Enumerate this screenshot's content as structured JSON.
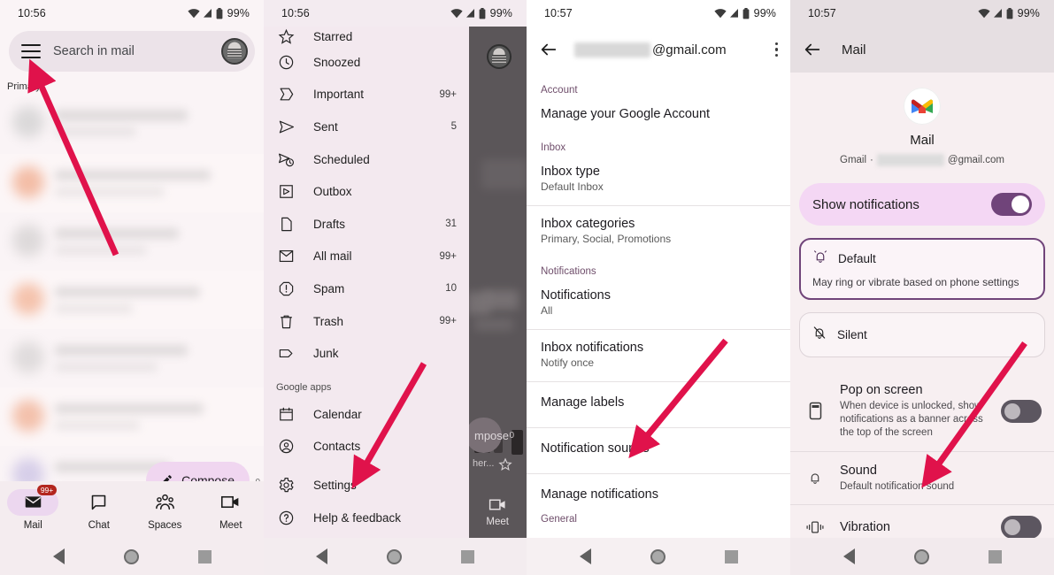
{
  "status_bar": {
    "time_1": "10:56",
    "time_2": "10:56",
    "time_3": "10:57",
    "time_4": "10:57",
    "battery": "99%"
  },
  "panel1": {
    "search": {
      "placeholder": "Search in mail",
      "menu_icon": "hamburger-menu-icon",
      "avatar_icon": "account-avatar"
    },
    "category_label": "Primary",
    "compose": {
      "label": "Compose",
      "icon": "pencil-icon"
    },
    "compose_side_mark": "0",
    "bottom_nav": [
      {
        "label": "Mail",
        "icon": "envelope-icon",
        "badge": "99+",
        "active": true
      },
      {
        "label": "Chat",
        "icon": "chat-bubble-icon",
        "badge": "",
        "active": false
      },
      {
        "label": "Spaces",
        "icon": "spaces-people-icon",
        "badge": "",
        "active": false
      },
      {
        "label": "Meet",
        "icon": "video-camera-icon",
        "badge": "",
        "active": false
      }
    ]
  },
  "panel2": {
    "items": [
      {
        "label": "Starred",
        "icon": "star-icon",
        "count": ""
      },
      {
        "label": "Snoozed",
        "icon": "clock-icon",
        "count": ""
      },
      {
        "label": "Important",
        "icon": "important-chevron-icon",
        "count": "99+"
      },
      {
        "label": "Sent",
        "icon": "paper-plane-icon",
        "count": "5"
      },
      {
        "label": "Scheduled",
        "icon": "scheduled-send-icon",
        "count": ""
      },
      {
        "label": "Outbox",
        "icon": "outbox-icon",
        "count": ""
      },
      {
        "label": "Drafts",
        "icon": "draft-page-icon",
        "count": "31"
      },
      {
        "label": "All mail",
        "icon": "all-mail-icon",
        "count": "99+"
      },
      {
        "label": "Spam",
        "icon": "spam-exclamation-icon",
        "count": "10"
      },
      {
        "label": "Trash",
        "icon": "trash-icon",
        "count": "99+"
      },
      {
        "label": "Junk",
        "icon": "label-tag-icon",
        "count": ""
      }
    ],
    "section_label": "Google apps",
    "apps": [
      {
        "label": "Calendar",
        "icon": "calendar-icon"
      },
      {
        "label": "Contacts",
        "icon": "contacts-person-icon"
      }
    ],
    "footer": [
      {
        "label": "Settings",
        "icon": "gear-icon"
      },
      {
        "label": "Help & feedback",
        "icon": "help-question-icon"
      }
    ],
    "overlay": {
      "compose_label": "mpose",
      "zero": "0",
      "her": "her...",
      "meet": "Meet"
    }
  },
  "panel3": {
    "email_suffix": "@gmail.com",
    "sections": [
      {
        "label": "Account",
        "rows": [
          {
            "title": "Manage your Google Account",
            "sub": ""
          }
        ]
      },
      {
        "label": "Inbox",
        "rows": [
          {
            "title": "Inbox type",
            "sub": "Default Inbox"
          },
          {
            "title": "Inbox categories",
            "sub": "Primary, Social, Promotions"
          }
        ]
      },
      {
        "label": "Notifications",
        "rows": [
          {
            "title": "Notifications",
            "sub": "All"
          },
          {
            "title": "Inbox notifications",
            "sub": "Notify once"
          },
          {
            "title": "Manage labels",
            "sub": ""
          },
          {
            "title": "Notification sounds",
            "sub": ""
          },
          {
            "title": "Manage notifications",
            "sub": ""
          }
        ]
      },
      {
        "label": "General",
        "rows": []
      }
    ]
  },
  "panel4": {
    "appbar_title": "Mail",
    "app_name": "Mail",
    "app_sub_prefix": "Gmail",
    "app_sub_separator": "·",
    "app_sub_suffix": "@gmail.com",
    "show_notifications": {
      "label": "Show notifications",
      "state": "on"
    },
    "importance": [
      {
        "label": "Default",
        "desc": "May ring or vibrate based on phone settings",
        "icon": "bell-ring-icon",
        "selected": true
      },
      {
        "label": "Silent",
        "desc": "",
        "icon": "bell-off-icon",
        "selected": false
      }
    ],
    "rows": [
      {
        "title": "Pop on screen",
        "sub": "When device is unlocked, show notifications as a banner across the top of the screen",
        "icon": "phone-banner-icon",
        "toggle": "off"
      },
      {
        "title": "Sound",
        "sub": "Default notification sound",
        "icon": "bell-icon",
        "toggle": ""
      },
      {
        "title": "Vibration",
        "sub": "",
        "icon": "vibration-icon",
        "toggle": "off"
      }
    ]
  },
  "annotations": {
    "arrow_color": "#e0124b",
    "arrows": [
      {
        "name": "arrow-to-hamburger-menu",
        "target": "hamburger-menu-icon"
      },
      {
        "name": "arrow-to-settings",
        "target": "Settings"
      },
      {
        "name": "arrow-to-notification-sounds",
        "target": "Notification sounds"
      },
      {
        "name": "arrow-to-sound",
        "target": "Sound"
      }
    ]
  },
  "colors": {
    "accent_purple": "#70447a",
    "pill_pink": "#f4d7f4",
    "badge_red": "#b3261e",
    "arrow_red": "#e0124b"
  }
}
